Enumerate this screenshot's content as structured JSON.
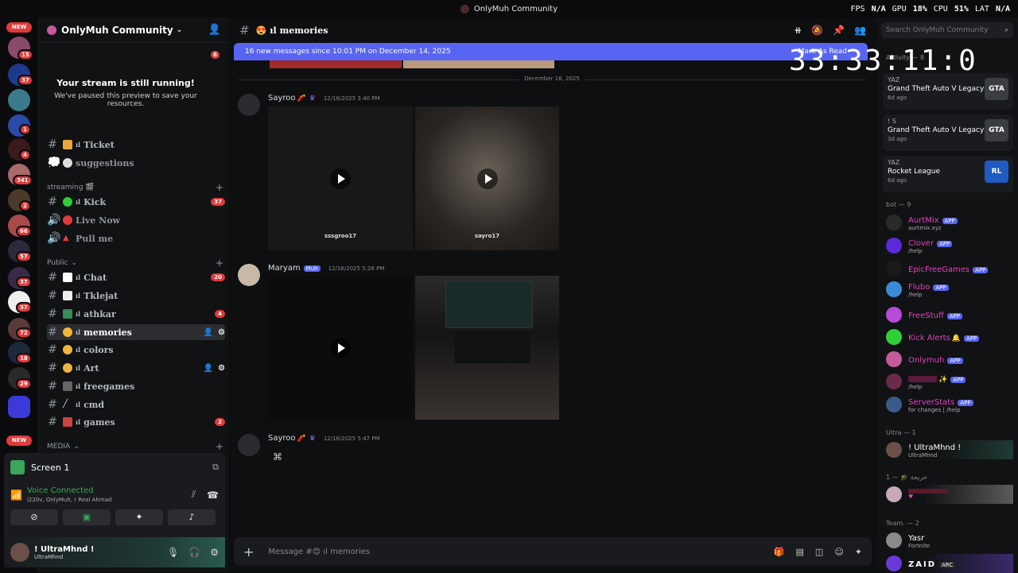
{
  "window": {
    "title": "OnlyMuh Community"
  },
  "overlay": {
    "fps_label": "FPS",
    "fps": "N/A",
    "gpu_label": "GPU",
    "gpu": "18%",
    "cpu_label": "CPU",
    "cpu": "51%",
    "lat_label": "LAT",
    "lat": "N/A"
  },
  "guilds": {
    "new_label": "NEW",
    "badges": [
      "15",
      "37",
      "1",
      "4",
      "341",
      "2",
      "66",
      "57",
      "37",
      "37",
      "72",
      "18",
      "29"
    ]
  },
  "server": {
    "name": "OnlyMuh Community",
    "unread_count": "6"
  },
  "stream_notice": {
    "title": "Your stream is still running!",
    "subtitle": "We've paused this preview to save your resources."
  },
  "channels": [
    {
      "name": "Ticket",
      "prefix": "ıl"
    },
    {
      "name": "suggestions",
      "prefix": ""
    },
    {
      "name": "Kick",
      "prefix": "ıl",
      "count": "37"
    },
    {
      "name": "Live Now",
      "prefix": ""
    },
    {
      "name": "Pull me",
      "prefix": ""
    },
    {
      "name": "Chat",
      "prefix": "ıl",
      "count": "20"
    },
    {
      "name": "Tklejat",
      "prefix": "ıl"
    },
    {
      "name": "athkar",
      "prefix": "ıl",
      "count": "4"
    },
    {
      "name": "memories",
      "prefix": "ıl"
    },
    {
      "name": "colors",
      "prefix": "ıl"
    },
    {
      "name": "Art",
      "prefix": "ıl"
    },
    {
      "name": "freegames",
      "prefix": "ıl"
    },
    {
      "name": "cmd",
      "prefix": "ıl"
    },
    {
      "name": "games",
      "prefix": "ıl",
      "count": "2"
    }
  ],
  "categories": {
    "streaming": "streaming 🎬",
    "public": "Public",
    "media": "MEDIA"
  },
  "screen_panel": {
    "label": "Screen 1"
  },
  "voice": {
    "status": "Voice Connected",
    "members": "i220v, OnlyMuh, ! Real Ahmad"
  },
  "user": {
    "name": "! UltraMhnd !",
    "status": "UltraMhnd"
  },
  "chat": {
    "channel_name": "memories",
    "new_messages": "16 new messages since 10:01 PM on December 14, 2025",
    "mark_read": "Mark As Read",
    "date_separator": "December 16, 2025",
    "messages": [
      {
        "author": "Sayroo",
        "time": "12/16/2025 3:40 PM",
        "captions": [
          "sssgroo17",
          "sayro17"
        ]
      },
      {
        "author": "Maryam",
        "tag": "Muh",
        "time": "12/16/2025 5:28 PM"
      },
      {
        "author": "Sayroo",
        "time": "12/16/2025 5:47 PM"
      }
    ],
    "composer_placeholder": "Message #😍 ıl memories"
  },
  "clock": "33:33:11:0",
  "members": {
    "search_placeholder": "Search OnlyMuh Community",
    "activity_header": "Activity — 8",
    "activities": [
      {
        "user": "YAZ",
        "game": "Grand Theft Auto V Legacy",
        "ago": "6d ago",
        "art": "GTA"
      },
      {
        "user": "! S",
        "game": "Grand Theft Auto V Legacy",
        "ago": "3d ago",
        "art": "GTA"
      },
      {
        "user": "YAZ",
        "game": "Rocket League",
        "ago": "6d ago",
        "art": "RL"
      }
    ],
    "bot_header": "bot — 9",
    "bots": [
      {
        "name": "AurtMix",
        "sub": "aurtmix.xyz"
      },
      {
        "name": "Clover",
        "sub": "/help"
      },
      {
        "name": "EpicFreeGames",
        "sub": ""
      },
      {
        "name": "Flubo",
        "sub": "/help"
      },
      {
        "name": "FreeStuff",
        "sub": ""
      },
      {
        "name": "Kick Alerts",
        "sub": ""
      },
      {
        "name": "Onlymuh",
        "sub": ""
      },
      {
        "name": "",
        "sub": "/help"
      },
      {
        "name": "ServerStats",
        "sub": "for changes | /help"
      }
    ],
    "ultra_header": "Ultra — 1",
    "ultra_member": {
      "name": "! UltraMhnd !",
      "sub": "UltraMhnd"
    },
    "arabic_header": "خريجة 🎓 — 1",
    "team_header": "Team. — 2",
    "team": [
      {
        "name": "Yasr",
        "sub": "Fortnite"
      },
      {
        "name": "ZAID",
        "sub": "ARC"
      }
    ],
    "app_label": "APP"
  }
}
